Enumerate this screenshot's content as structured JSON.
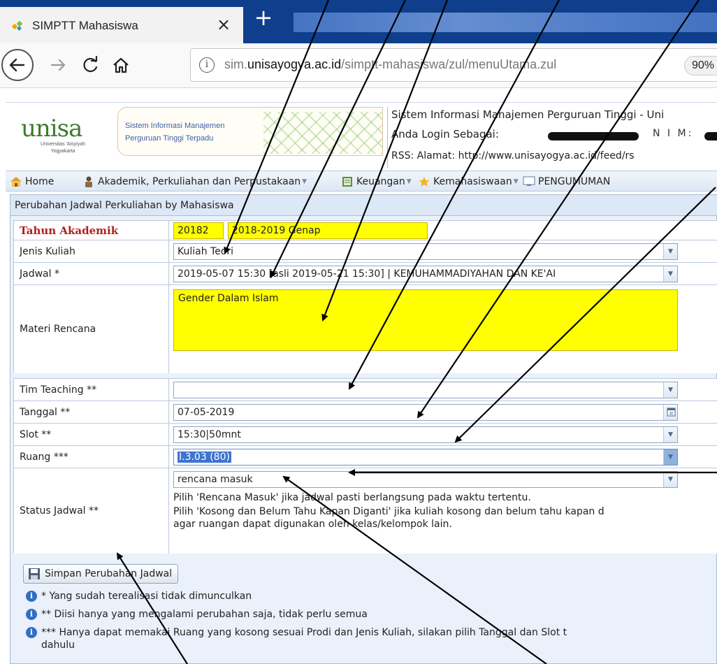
{
  "browser": {
    "tab_title": "SIMPTT Mahasiswa",
    "tab_close": "×",
    "new_tab": "+",
    "url_prefix": "sim.",
    "url_domain": "unisayogya.ac.id",
    "url_path": "/simptt-mahasiswa/zul/menuUtama.zul",
    "zoom": "90%"
  },
  "header": {
    "logo_word": "unisa",
    "logo_sub_1": "Universitas 'Aisyiyah",
    "logo_sub_2": "Yogyakarta",
    "banner_line1": "Sistem Informasi Manajemen",
    "banner_line2": "Perguruan Tinggi Terpadu",
    "line1": "Sistem Informasi Manajemen Perguruan Tinggi - Uni",
    "line2": "Anda Login Sebagai:",
    "nim_label": "N I M:",
    "line3": "RSS:    Alamat: http://www.unisayogya.ac.id/feed/rs"
  },
  "menu": {
    "items": [
      {
        "label": "Home",
        "icon": "home-icon"
      },
      {
        "label": "Akademik, Perkuliahan dan Perpustakaan",
        "icon": "person-icon"
      },
      {
        "label": "Keuangan",
        "icon": "ledger-icon"
      },
      {
        "label": "Kemahasiswaan",
        "icon": "star-icon"
      },
      {
        "label": "PENGUMUMAN",
        "icon": "monitor-icon"
      }
    ]
  },
  "panel": {
    "title": "Perubahan Jadwal Perkuliahan by Mahasiswa"
  },
  "form": {
    "tahun_label": "Tahun Akademik",
    "tahun_code": "20182",
    "tahun_name": "2018-2019 Genap",
    "jenis_label": "Jenis Kuliah",
    "jenis_value": "Kuliah Teori",
    "jadwal_label": "Jadwal *",
    "jadwal_value": "2019-05-07 15:30 [asli 2019-05-21 15:30] | KEMUHAMMADIYAHAN DAN KE'AI",
    "materi_label": "Materi Rencana",
    "materi_value": "Gender Dalam Islam",
    "tim_label": "Tim Teaching **",
    "tim_value": "",
    "tanggal_label": "Tanggal **",
    "tanggal_value": "07-05-2019",
    "slot_label": "Slot **",
    "slot_value": "15:30|50mnt",
    "ruang_label": "Ruang ***",
    "ruang_value": "I.3.03 (80)",
    "status_label": "Status Jadwal **",
    "status_value": "rencana masuk",
    "status_hint1": "Pilih 'Rencana Masuk' jika jadwal pasti berlangsung pada waktu tertentu.",
    "status_hint2": "Pilih 'Kosong dan Belum Tahu Kapan Diganti' jika kuliah kosong dan belum tahu kapan d",
    "status_hint3": "agar ruangan dapat digunakan oleh kelas/kelompok lain."
  },
  "actions": {
    "save_label": "Simpan Perubahan Jadwal"
  },
  "notes": {
    "note1": "* Yang sudah terealisasi tidak dimunculkan",
    "note2": "** Diisi hanya yang mengalami perubahan saja, tidak perlu semua",
    "note3": "*** Hanya dapat memakai Ruang yang kosong sesuai Prodi dan Jenis Kuliah, silakan pilih Tanggal dan Slot t",
    "note3b": "dahulu"
  },
  "colors": {
    "highlight_yellow": "#ffff00",
    "required_label_red": "#b0201c",
    "selection_blue": "#3e74cf",
    "browser_tabbar": "#0f3f8c"
  }
}
